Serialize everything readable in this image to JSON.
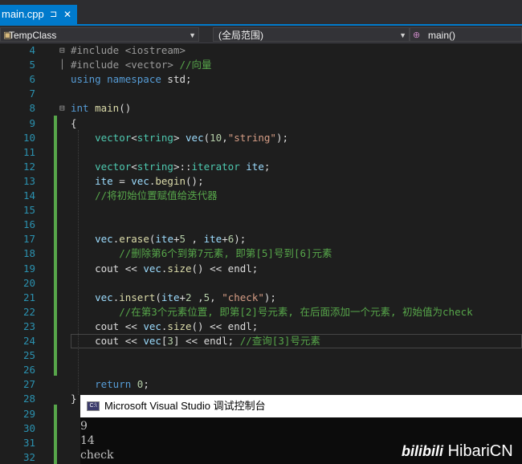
{
  "tab": {
    "filename": "main.cpp",
    "pin_glyph": "⊐",
    "close_glyph": "✕"
  },
  "navbar": {
    "class_scope": "TempClass",
    "global_scope": "(全局范围)",
    "member": "main()"
  },
  "code_lines": [
    {
      "n": "4",
      "fold": "⊟",
      "segs": [
        [
          "pp",
          "#include <iostream>"
        ]
      ]
    },
    {
      "n": "5",
      "fold": "│",
      "segs": [
        [
          "pp",
          "#include <vector> "
        ],
        [
          "cm",
          "//向量"
        ]
      ]
    },
    {
      "n": "6",
      "fold": "",
      "segs": [
        [
          "kw",
          "using namespace"
        ],
        [
          "pl",
          " std;"
        ]
      ]
    },
    {
      "n": "7",
      "fold": "",
      "segs": []
    },
    {
      "n": "8",
      "fold": "⊟",
      "segs": [
        [
          "kw",
          "int"
        ],
        [
          "pl",
          " "
        ],
        [
          "fn",
          "main"
        ],
        [
          "pl",
          "()"
        ]
      ]
    },
    {
      "n": "9",
      "fold": "",
      "segs": [
        [
          "pl",
          "{"
        ]
      ]
    },
    {
      "n": "10",
      "fold": "",
      "segs": [
        [
          "pl",
          "    "
        ],
        [
          "ty",
          "vector"
        ],
        [
          "pl",
          "<"
        ],
        [
          "ty",
          "string"
        ],
        [
          "pl",
          "> "
        ],
        [
          "var",
          "vec"
        ],
        [
          "pl",
          "("
        ],
        [
          "num",
          "10"
        ],
        [
          "pl",
          ","
        ],
        [
          "str",
          "\"string\""
        ],
        [
          "pl",
          ");"
        ]
      ]
    },
    {
      "n": "11",
      "fold": "",
      "segs": []
    },
    {
      "n": "12",
      "fold": "",
      "segs": [
        [
          "pl",
          "    "
        ],
        [
          "ty",
          "vector"
        ],
        [
          "pl",
          "<"
        ],
        [
          "ty",
          "string"
        ],
        [
          "pl",
          ">::"
        ],
        [
          "ty",
          "iterator"
        ],
        [
          "pl",
          " "
        ],
        [
          "var",
          "ite"
        ],
        [
          "pl",
          ";"
        ]
      ]
    },
    {
      "n": "13",
      "fold": "",
      "segs": [
        [
          "pl",
          "    "
        ],
        [
          "var",
          "ite"
        ],
        [
          "pl",
          " = "
        ],
        [
          "var",
          "vec"
        ],
        [
          "pl",
          "."
        ],
        [
          "fn",
          "begin"
        ],
        [
          "pl",
          "();"
        ]
      ]
    },
    {
      "n": "14",
      "fold": "",
      "segs": [
        [
          "pl",
          "    "
        ],
        [
          "cm",
          "//将初始位置赋值给迭代器"
        ]
      ]
    },
    {
      "n": "15",
      "fold": "",
      "segs": []
    },
    {
      "n": "16",
      "fold": "",
      "segs": []
    },
    {
      "n": "17",
      "fold": "",
      "segs": [
        [
          "pl",
          "    "
        ],
        [
          "var",
          "vec"
        ],
        [
          "pl",
          "."
        ],
        [
          "fn",
          "erase"
        ],
        [
          "pl",
          "("
        ],
        [
          "var",
          "ite"
        ],
        [
          "pl",
          "+"
        ],
        [
          "num",
          "5"
        ],
        [
          "pl",
          " , "
        ],
        [
          "var",
          "ite"
        ],
        [
          "pl",
          "+"
        ],
        [
          "num",
          "6"
        ],
        [
          "pl",
          ");"
        ]
      ]
    },
    {
      "n": "18",
      "fold": "",
      "segs": [
        [
          "pl",
          "        "
        ],
        [
          "cm",
          "//删除第6个到第7元素, 即第[5]号到[6]元素"
        ]
      ]
    },
    {
      "n": "19",
      "fold": "",
      "segs": [
        [
          "pl",
          "    cout << "
        ],
        [
          "var",
          "vec"
        ],
        [
          "pl",
          "."
        ],
        [
          "fn",
          "size"
        ],
        [
          "pl",
          "() << endl;"
        ]
      ]
    },
    {
      "n": "20",
      "fold": "",
      "segs": []
    },
    {
      "n": "21",
      "fold": "",
      "segs": [
        [
          "pl",
          "    "
        ],
        [
          "var",
          "vec"
        ],
        [
          "pl",
          "."
        ],
        [
          "fn",
          "insert"
        ],
        [
          "pl",
          "("
        ],
        [
          "var",
          "ite"
        ],
        [
          "pl",
          "+"
        ],
        [
          "num",
          "2"
        ],
        [
          "pl",
          " ,"
        ],
        [
          "num",
          "5"
        ],
        [
          "pl",
          ", "
        ],
        [
          "str",
          "\"check\""
        ],
        [
          "pl",
          ");"
        ]
      ]
    },
    {
      "n": "22",
      "fold": "",
      "segs": [
        [
          "pl",
          "        "
        ],
        [
          "cm",
          "//在第3个元素位置, 即第[2]号元素, 在后面添加一个元素, 初始值为check"
        ]
      ]
    },
    {
      "n": "23",
      "fold": "",
      "segs": [
        [
          "pl",
          "    cout << "
        ],
        [
          "var",
          "vec"
        ],
        [
          "pl",
          "."
        ],
        [
          "fn",
          "size"
        ],
        [
          "pl",
          "() << endl;"
        ]
      ]
    },
    {
      "n": "24",
      "fold": "",
      "segs": [
        [
          "pl",
          "    cout << "
        ],
        [
          "var",
          "vec"
        ],
        [
          "pl",
          "["
        ],
        [
          "num",
          "3"
        ],
        [
          "pl",
          "] << endl; "
        ],
        [
          "cm",
          "//查询[3]号元素"
        ]
      ]
    },
    {
      "n": "25",
      "fold": "",
      "segs": []
    },
    {
      "n": "26",
      "fold": "",
      "segs": []
    },
    {
      "n": "27",
      "fold": "",
      "segs": [
        [
          "pl",
          "    "
        ],
        [
          "kw",
          "return"
        ],
        [
          "pl",
          " "
        ],
        [
          "num",
          "0"
        ],
        [
          "pl",
          ";"
        ]
      ]
    },
    {
      "n": "28",
      "fold": "",
      "segs": [
        [
          "pl",
          "}"
        ]
      ]
    },
    {
      "n": "29",
      "fold": "",
      "segs": []
    },
    {
      "n": "30",
      "fold": "",
      "segs": []
    },
    {
      "n": "31",
      "fold": "",
      "segs": []
    },
    {
      "n": "32",
      "fold": "",
      "segs": []
    }
  ],
  "console": {
    "title": "Microsoft Visual Studio 调试控制台",
    "icon_text": "C:\\",
    "output": [
      "9",
      "14",
      "check"
    ]
  },
  "watermark": {
    "brand": "bilibili",
    "user": "HibariCN"
  }
}
